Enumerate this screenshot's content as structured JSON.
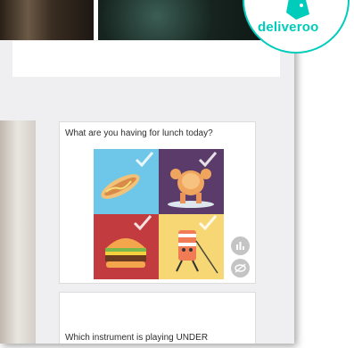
{
  "brand": {
    "name": "deliveroo",
    "color": "#00ccbc"
  },
  "cards": [
    {
      "question": "What are you having for lunch today?",
      "options": [
        {
          "icon": "hot-dog-icon",
          "background": "#6ec6e8",
          "checked": true
        },
        {
          "icon": "roast-chicken-surfboard-icon",
          "background": "#5a3b69",
          "checked": true
        },
        {
          "icon": "burger-icon",
          "background": "#c23b3e",
          "checked": true
        },
        {
          "icon": "sushi-roll-character-icon",
          "background": "#f6d774",
          "checked": true
        }
      ],
      "side_icons": [
        "stats-icon",
        "hide-icon"
      ]
    },
    {
      "question": "Which instrument is playing UNDER"
    }
  ]
}
